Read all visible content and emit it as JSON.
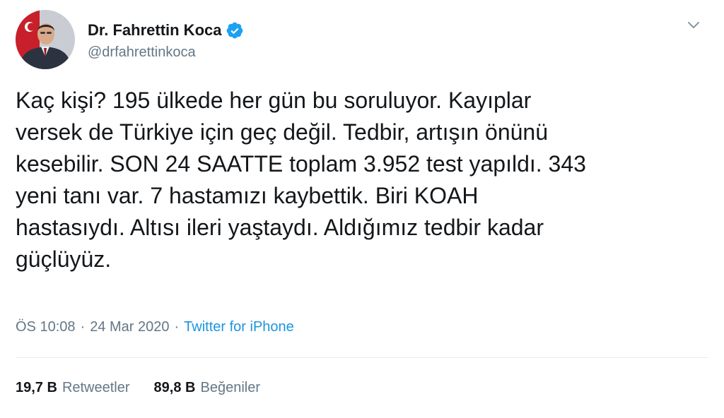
{
  "author": {
    "display_name": "Dr. Fahrettin Koca",
    "handle": "@drfahrettinkoca",
    "verified_icon": "verified-badge-icon"
  },
  "tweet": {
    "text": "Kaç kişi? 195 ülkede her gün bu soruluyor. Kayıplar\nversek de Türkiye için geç değil. Tedbir, artışın önünü\nkesebilir. SON 24 SAATTE toplam 3.952 test yapıldı. 343\nyeni tanı var. 7 hastamızı kaybettik. Biri KOAH\nhastasıydı. Altısı ileri yaştaydı. Aldığımız tedbir kadar\ngüçlüyüz.",
    "time": "ÖS 10:08",
    "separator": "·",
    "date": "24 Mar 2020",
    "source": "Twitter for iPhone"
  },
  "stats": {
    "retweets_count": "19,7 B",
    "retweets_label": "Retweetler",
    "likes_count": "89,8 B",
    "likes_label": "Beğeniler"
  },
  "colors": {
    "text": "#14171a",
    "secondary": "#657786",
    "link": "#1b95e0",
    "verified": "#1da1f2",
    "divider": "#e6ecf0"
  }
}
